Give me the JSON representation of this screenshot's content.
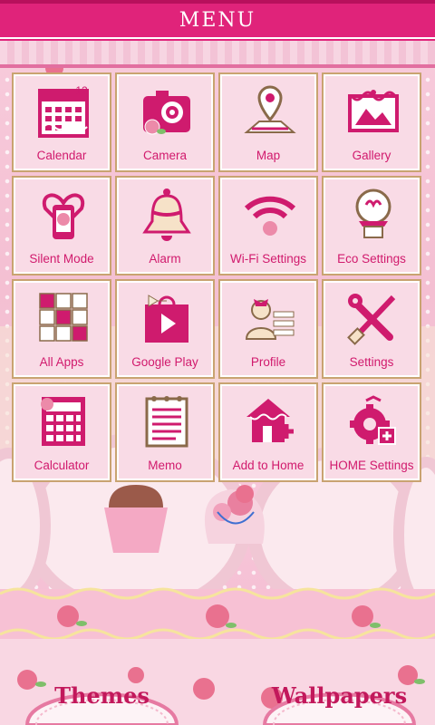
{
  "header": {
    "title": "MENU"
  },
  "apps": [
    {
      "label": "Calendar",
      "icon": "calendar-icon",
      "badge": "12"
    },
    {
      "label": "Camera",
      "icon": "camera-icon"
    },
    {
      "label": "Map",
      "icon": "map-pin-icon"
    },
    {
      "label": "Gallery",
      "icon": "gallery-icon"
    },
    {
      "label": "Silent Mode",
      "icon": "silent-mode-phone-icon"
    },
    {
      "label": "Alarm",
      "icon": "alarm-bell-icon"
    },
    {
      "label": "Wi-Fi Settings",
      "icon": "wifi-icon"
    },
    {
      "label": "Eco Settings",
      "icon": "eco-lightbulb-icon"
    },
    {
      "label": "All Apps",
      "icon": "all-apps-grid-icon"
    },
    {
      "label": "Google Play",
      "icon": "google-play-icon"
    },
    {
      "label": "Profile",
      "icon": "profile-icon"
    },
    {
      "label": "Settings",
      "icon": "wrench-screwdriver-icon"
    },
    {
      "label": "Calculator",
      "icon": "calculator-icon"
    },
    {
      "label": "Memo",
      "icon": "memo-notepad-icon"
    },
    {
      "label": "Add to Home",
      "icon": "add-to-home-icon"
    },
    {
      "label": "HOME Settings",
      "icon": "home-settings-gear-icon"
    }
  ],
  "bottom": {
    "themes_label": "Themes",
    "wallpapers_label": "Wallpapers"
  },
  "colors": {
    "accent": "#e0237a",
    "label": "#d11a6d",
    "tile_bg": "#f9dbe6",
    "tile_border": "#c9a371",
    "icon": "#cf1b6e"
  }
}
